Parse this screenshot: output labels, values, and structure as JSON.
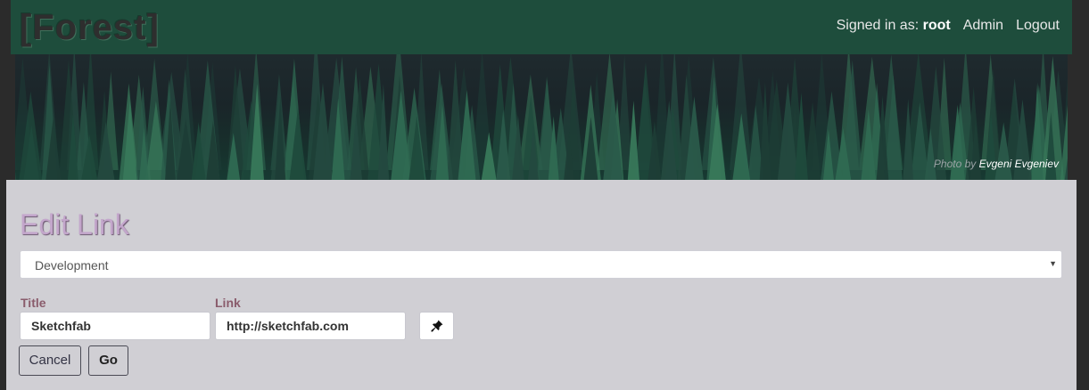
{
  "header": {
    "brand": "[Forest]",
    "signed_in_label": "Signed in as:",
    "username": "root",
    "admin_link": "Admin",
    "logout_link": "Logout"
  },
  "hero": {
    "credit_prefix": "Photo by",
    "credit_author": "Evgeni Evgeniev"
  },
  "form": {
    "page_title": "Edit Link",
    "category_select": {
      "selected": "Development"
    },
    "title_label": "Title",
    "title_value": "Sketchfab",
    "link_label": "Link",
    "link_value": "http://sketchfab.com",
    "pin_icon": "pin-icon",
    "cancel_label": "Cancel",
    "go_label": "Go"
  },
  "colors": {
    "navbar": "#1e4d3c",
    "content_bg": "#d0cfd4",
    "title_color": "#c3a6cb",
    "label_color": "#8a5c6c"
  }
}
